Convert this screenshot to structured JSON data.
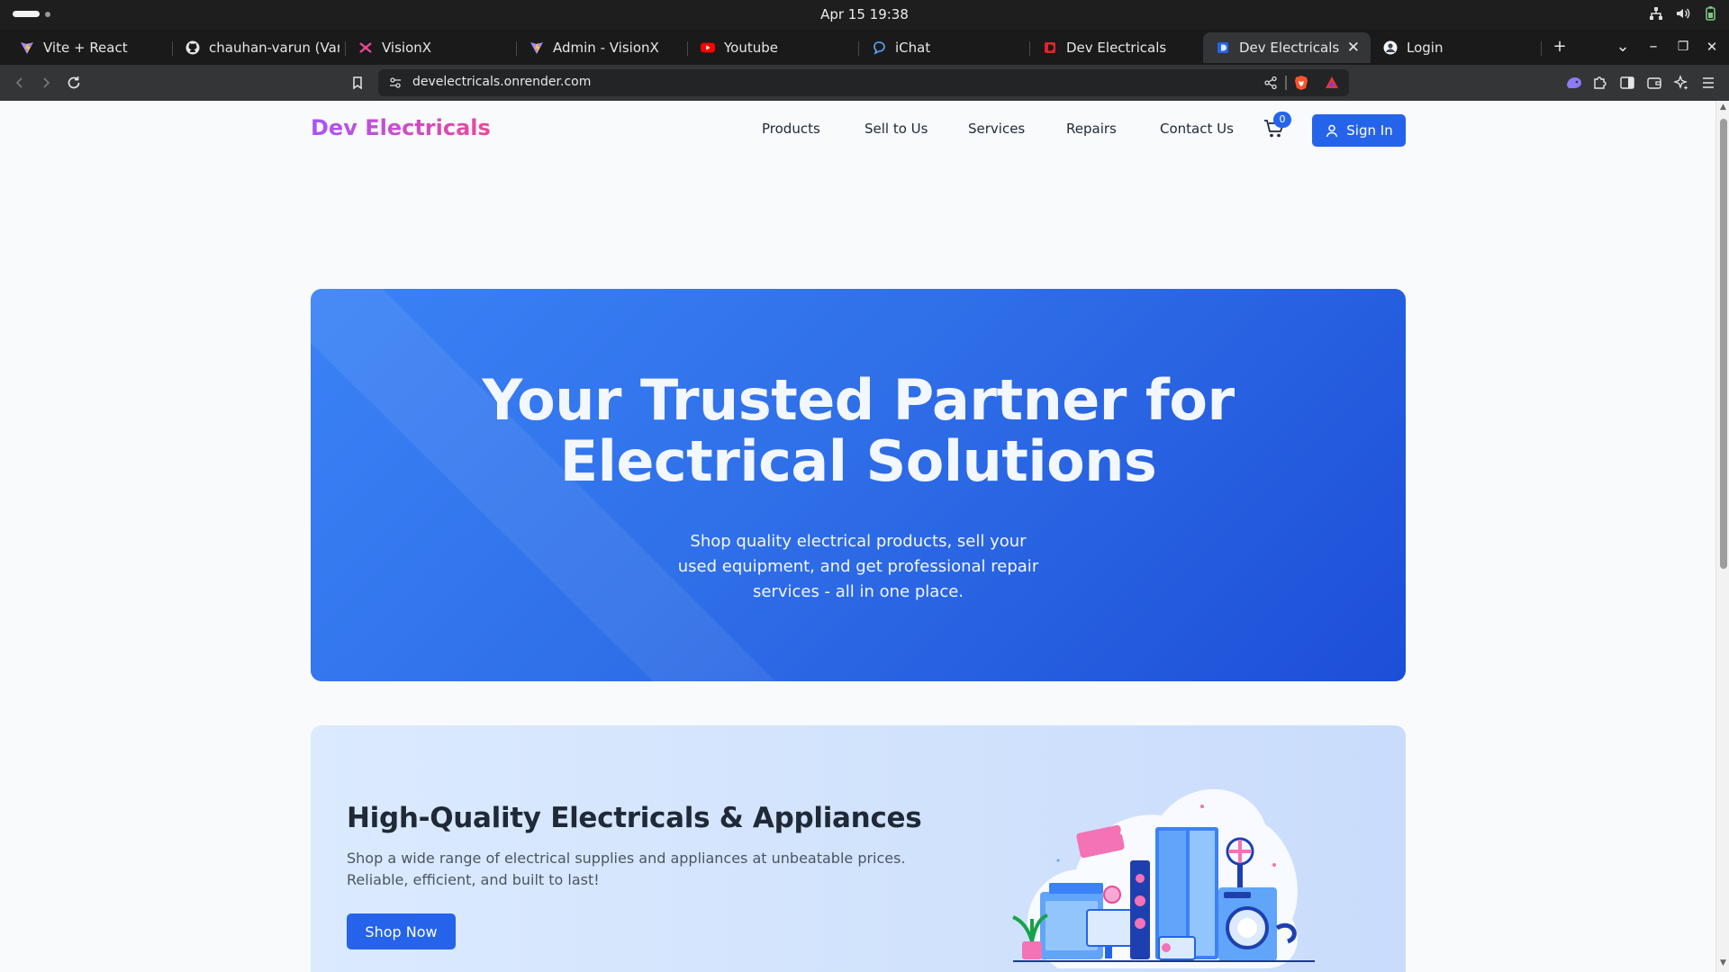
{
  "os": {
    "clock": "Apr 15  19:38",
    "tray_icons": [
      "network-icon",
      "volume-icon",
      "battery-icon"
    ]
  },
  "tabs": [
    {
      "title": "Vite + React",
      "icon": "vite-icon",
      "active": false
    },
    {
      "title": "chauhan-varun (Varun",
      "icon": "github-icon",
      "active": false
    },
    {
      "title": "VisionX",
      "icon": "visionx-icon",
      "active": false
    },
    {
      "title": "Admin - VisionX",
      "icon": "vite-icon",
      "active": false
    },
    {
      "title": "Youtube",
      "icon": "youtube-icon",
      "active": false
    },
    {
      "title": "iChat",
      "icon": "chat-icon",
      "active": false
    },
    {
      "title": "Dev Electricals",
      "icon": "dev-electricals-icon",
      "active": false
    },
    {
      "title": "Dev Electricals",
      "icon": "dev-electricals-icon",
      "active": true
    },
    {
      "title": "Login",
      "icon": "login-icon",
      "active": false
    }
  ],
  "tab_controls": {
    "new_tab": "+",
    "tab_list": "⌄",
    "minimize": "–",
    "restore": "❐",
    "close": "✕"
  },
  "toolbar": {
    "url": "develectricals.onrender.com"
  },
  "site": {
    "brand": "Dev Electricals",
    "nav": [
      "Products",
      "Sell to Us",
      "Services",
      "Repairs",
      "Contact Us"
    ],
    "cart_count": "0",
    "sign_in": "Sign In",
    "colors": {
      "primary": "#2563eb",
      "brand_from": "#a855f7",
      "brand_to": "#ec4899"
    }
  },
  "hero": {
    "title_line1": "Your Trusted Partner for",
    "title_line2": "Electrical Solutions",
    "subtitle": "Shop quality electrical products, sell your used equipment, and get professional repair services - all in one place."
  },
  "feature": {
    "title": "High-Quality Electricals & Appliances",
    "description": "Shop a wide range of electrical supplies and appliances at unbeatable prices. Reliable, efficient, and built to last!",
    "button": "Shop Now",
    "illustration": "appliances-illustration"
  }
}
